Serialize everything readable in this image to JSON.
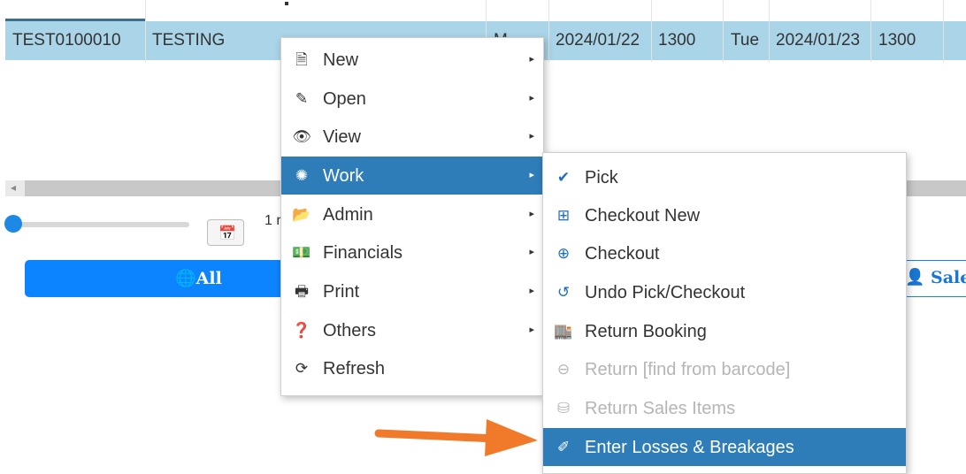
{
  "grid": {
    "row": {
      "code": "TEST0100010",
      "name": "TESTING",
      "partial": "M",
      "start_date": "2024/01/22",
      "start_time": "1300",
      "day": "Tue",
      "end_date": "2024/01/23",
      "end_time": "1300"
    }
  },
  "slider": {
    "label_partial": "1 r",
    "value": 0
  },
  "buttons": {
    "all": "All",
    "sales": "Sale"
  },
  "context_menu": {
    "items": [
      {
        "label": "New",
        "icon": "file-icon",
        "submenu": true
      },
      {
        "label": "Open",
        "icon": "edit-icon",
        "submenu": true
      },
      {
        "label": "View",
        "icon": "eye-icon",
        "submenu": true
      },
      {
        "label": "Work",
        "icon": "spinner-icon",
        "submenu": true,
        "highlighted": true
      },
      {
        "label": "Admin",
        "icon": "folder-icon",
        "submenu": true
      },
      {
        "label": "Financials",
        "icon": "money-icon",
        "submenu": true
      },
      {
        "label": "Print",
        "icon": "print-icon",
        "submenu": true
      },
      {
        "label": "Others",
        "icon": "question-icon",
        "submenu": true
      },
      {
        "label": "Refresh",
        "icon": "refresh-icon",
        "submenu": false
      }
    ]
  },
  "work_submenu": {
    "items": [
      {
        "label": "Pick",
        "icon": "check-icon"
      },
      {
        "label": "Checkout New",
        "icon": "plus-square-icon"
      },
      {
        "label": "Checkout",
        "icon": "plus-circle-icon"
      },
      {
        "label": "Undo Pick/Checkout",
        "icon": "undo-icon"
      },
      {
        "label": "Return Booking",
        "icon": "warehouse-icon"
      },
      {
        "label": "Return [find from barcode]",
        "icon": "arrow-left-circle-icon",
        "disabled": true
      },
      {
        "label": "Return Sales Items",
        "icon": "sales-return-icon",
        "disabled": true
      },
      {
        "label": "Enter Losses & Breakages",
        "icon": "broken-icon",
        "highlighted": true
      }
    ]
  },
  "colors": {
    "selected_row": "#aad4e8",
    "menu_highlight": "#2e7db8",
    "primary_button": "#0d84ff",
    "annotation_arrow": "#f07a2a"
  }
}
